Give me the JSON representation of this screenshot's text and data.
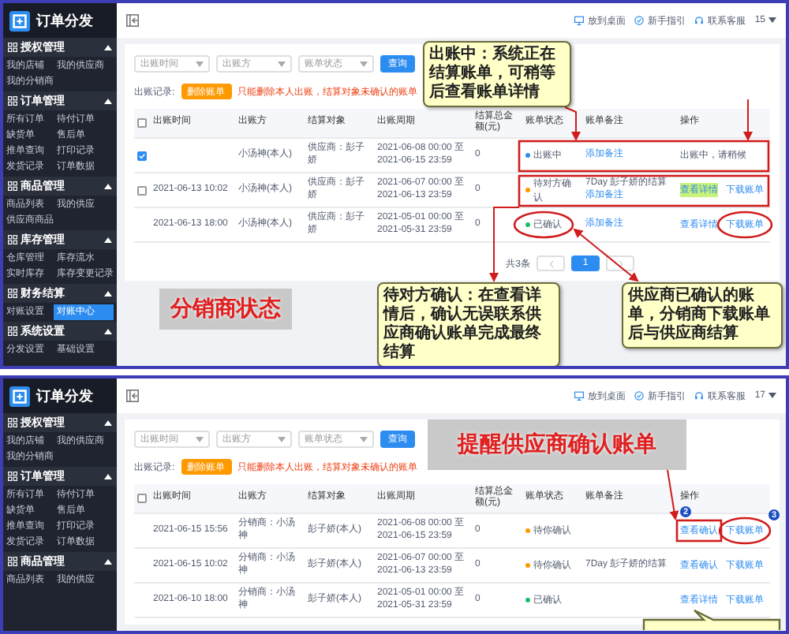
{
  "panels": [
    {
      "app_title": "订单分发",
      "header_links": [
        "放到桌面",
        "新手指引",
        "联系客服"
      ],
      "user": "15",
      "sidebar": [
        {
          "title": "授权管理",
          "expanded": true,
          "items": [
            {
              "label": "我的店铺",
              "selected": false
            },
            {
              "label": "我的供应商",
              "selected": false
            },
            {
              "label": "我的分销商",
              "selected": false
            }
          ]
        },
        {
          "title": "订单管理",
          "expanded": true,
          "items": [
            {
              "label": "所有订单",
              "selected": false
            },
            {
              "label": "待付订单",
              "selected": false
            },
            {
              "label": "缺货单",
              "selected": false
            },
            {
              "label": "售后单",
              "selected": false
            },
            {
              "label": "推单查询",
              "selected": false
            },
            {
              "label": "打印记录",
              "selected": false
            },
            {
              "label": "发货记录",
              "selected": false
            },
            {
              "label": "订单数据",
              "selected": false
            }
          ]
        },
        {
          "title": "商品管理",
          "expanded": true,
          "items": [
            {
              "label": "商品列表",
              "selected": false
            },
            {
              "label": "我的供应",
              "selected": false
            },
            {
              "label": "供应商商品",
              "selected": false
            }
          ]
        },
        {
          "title": "库存管理",
          "expanded": true,
          "items": [
            {
              "label": "仓库管理",
              "selected": false
            },
            {
              "label": "库存流水",
              "selected": false
            },
            {
              "label": "实时库存",
              "selected": false
            },
            {
              "label": "库存变更记录",
              "selected": false
            }
          ]
        },
        {
          "title": "财务结算",
          "expanded": true,
          "items": [
            {
              "label": "对账设置",
              "selected": false
            },
            {
              "label": "对账中心",
              "selected": true
            }
          ]
        },
        {
          "title": "系统设置",
          "expanded": true,
          "items": [
            {
              "label": "分发设置",
              "selected": false
            },
            {
              "label": "基础设置",
              "selected": false
            }
          ]
        }
      ],
      "filters": [
        {
          "placeholder": "出账时间"
        },
        {
          "placeholder": "出账方"
        },
        {
          "placeholder": "账单状态"
        }
      ],
      "search_button": "查询",
      "toolbar": {
        "label": "出账记录:",
        "button": "删除账单",
        "note": "只能删除本人出账，结算对象未确认的账单"
      },
      "table": {
        "select_all": {
          "checked": false
        },
        "columns": [
          "出账时间",
          "出账方",
          "结算对象",
          "出账周期",
          "结算总金额(元)",
          "账单状态",
          "账单备注",
          "操作"
        ],
        "rows": [
          {
            "checked": true,
            "cells": [
              "",
              "小汤神(本人)",
              "供应商：彭子娇",
              "2021-06-08 00:00 至 2021-06-15 23:59",
              "0"
            ],
            "status": {
              "text": "出账中",
              "color": "#2d8cf0"
            },
            "remark": {
              "link": "添加备注"
            },
            "actions": [
              {
                "kind": "text",
                "text": "出账中，请稍候",
                "highlighted": false
              }
            ]
          },
          {
            "checked": false,
            "cells": [
              "2021-06-13 10:02",
              "小汤神(本人)",
              "供应商：彭子娇",
              "2021-06-07 00:00 至 2021-06-13 23:59",
              "0"
            ],
            "status": {
              "text": "待对方确认",
              "color": "#ff9900"
            },
            "remark": {
              "text": "7Day 彭子娇的结算",
              "link": "添加备注"
            },
            "actions": [
              {
                "kind": "link",
                "text": "查看详情",
                "highlighted": true
              },
              {
                "kind": "link",
                "text": "下载账单",
                "highlighted": false
              }
            ]
          },
          {
            "cells": [
              "2021-06-13 18:00",
              "小汤神(本人)",
              "供应商：彭子娇",
              "2021-05-01 00:00 至 2021-05-31 23:59",
              "0"
            ],
            "status": {
              "text": "已确认",
              "color": "#19be6b"
            },
            "remark": {
              "link": "添加备注"
            },
            "actions": [
              {
                "kind": "link",
                "text": "查看详情",
                "highlighted": false
              },
              {
                "kind": "link",
                "text": "下载账单",
                "highlighted": false
              }
            ]
          }
        ]
      },
      "pagination": {
        "total": "共3条",
        "pages": [
          {
            "label": "1",
            "selected": true
          }
        ]
      },
      "annotations": [
        {
          "kind": "label",
          "text": "分销商状态"
        },
        {
          "kind": "callout",
          "text": "出账中：系统正在结算账单，可稍等后查看账单详情"
        },
        {
          "kind": "callout",
          "text": "待对方确认：在查看详情后，确认无误联系供应商确认账单完成最终结算"
        },
        {
          "kind": "callout",
          "text": "供应商已确认的账单，分销商下载账单后与供应商结算"
        }
      ]
    },
    {
      "app_title": "订单分发",
      "header_links": [
        "放到桌面",
        "新手指引",
        "联系客服"
      ],
      "user": "17",
      "sidebar": [
        {
          "title": "授权管理",
          "expanded": true,
          "items": [
            {
              "label": "我的店铺",
              "selected": false
            },
            {
              "label": "我的供应商",
              "selected": false
            },
            {
              "label": "我的分销商",
              "selected": false
            }
          ]
        },
        {
          "title": "订单管理",
          "expanded": true,
          "items": [
            {
              "label": "所有订单",
              "selected": false
            },
            {
              "label": "待付订单",
              "selected": false
            },
            {
              "label": "缺货单",
              "selected": false
            },
            {
              "label": "售后单",
              "selected": false
            },
            {
              "label": "推单查询",
              "selected": false
            },
            {
              "label": "打印记录",
              "selected": false
            },
            {
              "label": "发货记录",
              "selected": false
            },
            {
              "label": "订单数据",
              "selected": false
            }
          ]
        },
        {
          "title": "商品管理",
          "expanded": true,
          "items": [
            {
              "label": "商品列表",
              "selected": false
            },
            {
              "label": "我的供应",
              "selected": false
            }
          ]
        }
      ],
      "filters": [
        {
          "placeholder": "出账时间"
        },
        {
          "placeholder": "出账方"
        },
        {
          "placeholder": "账单状态"
        }
      ],
      "search_button": "查询",
      "toolbar": {
        "label": "出账记录:",
        "button": "删除账单",
        "note": "只能删除本人出账，结算对象未确认的账单"
      },
      "table": {
        "select_all": {
          "checked": false
        },
        "columns": [
          "出账时间",
          "出账方",
          "结算对象",
          "出账周期",
          "结算总金额(元)",
          "账单状态",
          "账单备注",
          "操作"
        ],
        "rows": [
          {
            "cells": [
              "2021-06-15 15:56",
              "分销商：小汤神",
              "彭子娇(本人)",
              "2021-06-08 00:00 至 2021-06-15 23:59",
              "0"
            ],
            "status": {
              "text": "待你确认",
              "color": "#ff9900"
            },
            "actions": [
              {
                "kind": "link",
                "text": "查看确认",
                "highlighted": false
              },
              {
                "kind": "link",
                "text": "下载账单",
                "highlighted": false
              }
            ]
          },
          {
            "cells": [
              "2021-06-15 10:02",
              "分销商：小汤神",
              "彭子娇(本人)",
              "2021-06-07 00:00 至 2021-06-13 23:59",
              "0"
            ],
            "status": {
              "text": "待你确认",
              "color": "#ff9900"
            },
            "remark": {
              "text": "7Day 彭子娇的结算"
            },
            "actions": [
              {
                "kind": "link",
                "text": "查看确认",
                "highlighted": false
              },
              {
                "kind": "link",
                "text": "下载账单",
                "highlighted": false
              }
            ]
          },
          {
            "cells": [
              "2021-06-10 18:00",
              "分销商：小汤神",
              "彭子娇(本人)",
              "2021-05-01 00:00 至 2021-05-31 23:59",
              "0"
            ],
            "status": {
              "text": "已确认",
              "color": "#19be6b"
            },
            "actions": [
              {
                "kind": "link",
                "text": "查看详情",
                "highlighted": false
              },
              {
                "kind": "link",
                "text": "下载账单",
                "highlighted": false
              }
            ]
          }
        ]
      },
      "annotations": [
        {
          "kind": "label",
          "text": "提醒供应商确认账单"
        },
        {
          "kind": "badge",
          "text": "2"
        },
        {
          "kind": "badge",
          "text": "3"
        }
      ]
    }
  ]
}
